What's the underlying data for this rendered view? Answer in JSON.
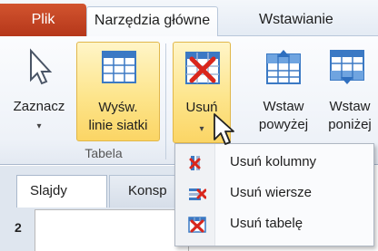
{
  "tabs": {
    "file": "Plik",
    "home": "Narzędzia główne",
    "insert": "Wstawianie"
  },
  "ribbon": {
    "select": {
      "label": "Zaznacz",
      "icon": "cursor-arrow-icon"
    },
    "gridlines": {
      "label_line1": "Wyśw.",
      "label_line2": "linie siatki",
      "icon": "table-grid-icon"
    },
    "delete": {
      "label": "Usuń",
      "icon": "delete-table-icon"
    },
    "insert_above": {
      "label_line1": "Wstaw",
      "label_line2": "powyżej",
      "icon": "insert-above-icon"
    },
    "insert_below": {
      "label_line1": "Wstaw",
      "label_line2": "poniżej",
      "icon": "insert-below-icon"
    },
    "group_label": "Tabela"
  },
  "pane": {
    "slides_tab": "Slajdy",
    "outline_tab": "Konsp",
    "slide_number": "2"
  },
  "menu": {
    "items": [
      {
        "label": "Usuń kolumny",
        "icon": "delete-columns-icon"
      },
      {
        "label": "Usuń wiersze",
        "icon": "delete-rows-icon"
      },
      {
        "label": "Usuń tabelę",
        "icon": "delete-table-icon"
      }
    ]
  },
  "colors": {
    "file_tab": "#c4462a",
    "highlight": "#fde58c",
    "delete_red": "#d9261c",
    "table_blue": "#3b79c4"
  }
}
